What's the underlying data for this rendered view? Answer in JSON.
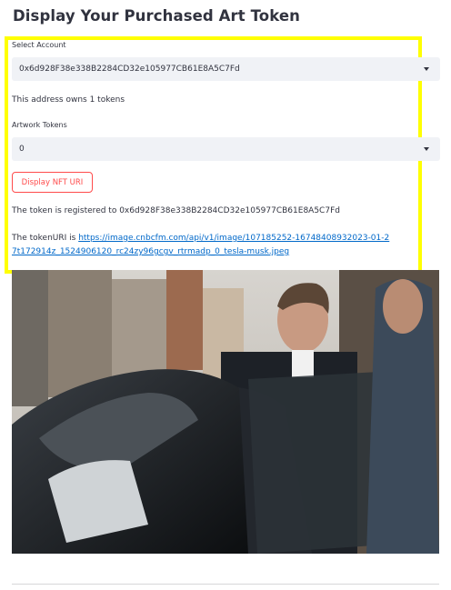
{
  "page_title": "Display Your Purchased Art Token",
  "account": {
    "label": "Select Account",
    "selected": "0x6d928F38e338B2284CD32e105977CB61E8A5C7Fd"
  },
  "owns_text": "This address owns 1 tokens",
  "artwork": {
    "label": "Artwork Tokens",
    "selected": "0"
  },
  "display_button_label": "Display NFT URI",
  "registered_text": "The token is registered to 0x6d928F38e338B2284CD32e105977CB61E8A5C7Fd",
  "token_uri": {
    "prefix": "The tokenURI is ",
    "url": "https://image.cnbcfm.com/api/v1/image/107185252-16748408932023-01-27t172914z_1524906120_rc24zy96gcgv_rtrmadp_0_tesla-musk.jpeg"
  },
  "colors": {
    "highlight": "#ffff00",
    "button_accent": "#ff4b4b",
    "link": "#0068c9",
    "select_bg": "#f0f2f6"
  }
}
